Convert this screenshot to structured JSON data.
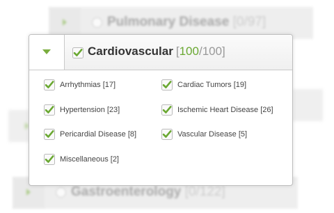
{
  "background_rows": {
    "top": {
      "title": "Pulmonary Disease",
      "count": "[0/97]"
    },
    "bottom": {
      "title": "Gastroenterology",
      "count": "[0/122]"
    }
  },
  "category": {
    "title": "Cardiovascular",
    "count_open": "[",
    "count_selected": "100",
    "count_separator": "/",
    "count_total": "100]",
    "checked": true
  },
  "items": [
    {
      "label": "Arrhythmias [17]",
      "checked": true
    },
    {
      "label": "Cardiac Tumors [19]",
      "checked": true
    },
    {
      "label": "Hypertension [23]",
      "checked": true
    },
    {
      "label": "Ischemic Heart Disease [26]",
      "checked": true
    },
    {
      "label": "Pericardial Disease [8]",
      "checked": true
    },
    {
      "label": "Vascular Disease [5]",
      "checked": true
    },
    {
      "label": "Miscellaneous [2]",
      "checked": true
    }
  ],
  "colors": {
    "accent": "#7aad3e",
    "count_selected": "#6aa832",
    "border": "#bdbdbd"
  },
  "icons": {
    "expanded": "triangle-down-icon",
    "collapsed": "triangle-right-icon",
    "check": "checkmark-icon"
  }
}
